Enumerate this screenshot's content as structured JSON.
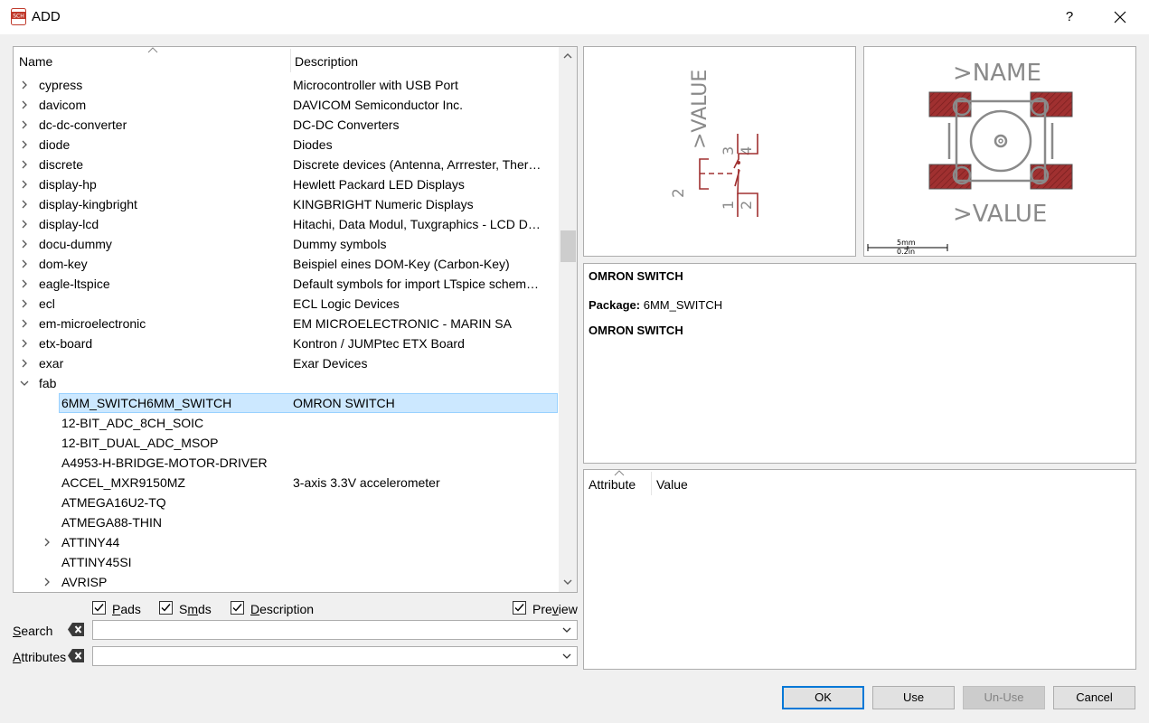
{
  "window": {
    "title": "ADD",
    "help_label": "?"
  },
  "tree": {
    "columns": {
      "name": "Name",
      "description": "Description"
    },
    "rows": [
      {
        "name": "cypress",
        "description": "Microcontroller with USB Port",
        "level": 0,
        "expander": "collapsed"
      },
      {
        "name": "davicom",
        "description": "DAVICOM Semiconductor Inc.",
        "level": 0,
        "expander": "collapsed"
      },
      {
        "name": "dc-dc-converter",
        "description": "DC-DC Converters",
        "level": 0,
        "expander": "collapsed"
      },
      {
        "name": "diode",
        "description": "Diodes",
        "level": 0,
        "expander": "collapsed"
      },
      {
        "name": "discrete",
        "description": "Discrete devices (Antenna, Arrrester, Ther…",
        "level": 0,
        "expander": "collapsed"
      },
      {
        "name": "display-hp",
        "description": "Hewlett Packard LED Displays",
        "level": 0,
        "expander": "collapsed"
      },
      {
        "name": "display-kingbright",
        "description": "KINGBRIGHT Numeric Displays",
        "level": 0,
        "expander": "collapsed"
      },
      {
        "name": "display-lcd",
        "description": "Hitachi, Data Modul, Tuxgraphics - LCD D…",
        "level": 0,
        "expander": "collapsed"
      },
      {
        "name": "docu-dummy",
        "description": "Dummy symbols",
        "level": 0,
        "expander": "collapsed"
      },
      {
        "name": "dom-key",
        "description": "Beispiel eines DOM-Key (Carbon-Key)",
        "level": 0,
        "expander": "collapsed"
      },
      {
        "name": "eagle-ltspice",
        "description": "Default symbols for import LTspice schem…",
        "level": 0,
        "expander": "collapsed"
      },
      {
        "name": "ecl",
        "description": "ECL Logic Devices",
        "level": 0,
        "expander": "collapsed"
      },
      {
        "name": "em-microelectronic",
        "description": "EM MICROELECTRONIC - MARIN SA",
        "level": 0,
        "expander": "collapsed"
      },
      {
        "name": "etx-board",
        "description": "Kontron / JUMPtec ETX Board",
        "level": 0,
        "expander": "collapsed"
      },
      {
        "name": "exar",
        "description": "Exar Devices",
        "level": 0,
        "expander": "collapsed"
      },
      {
        "name": "fab",
        "description": "",
        "level": 0,
        "expander": "expanded"
      },
      {
        "name": "6MM_SWITCH6MM_SWITCH",
        "description": "OMRON SWITCH",
        "level": 1,
        "expander": "none",
        "selected": true
      },
      {
        "name": "12-BIT_ADC_8CH_SOIC",
        "description": "",
        "level": 1,
        "expander": "none"
      },
      {
        "name": "12-BIT_DUAL_ADC_MSOP",
        "description": "",
        "level": 1,
        "expander": "none"
      },
      {
        "name": "A4953-H-BRIDGE-MOTOR-DRIVER",
        "description": "",
        "level": 1,
        "expander": "none"
      },
      {
        "name": "ACCEL_MXR9150MZ",
        "description": "3-axis 3.3V accelerometer",
        "level": 1,
        "expander": "none"
      },
      {
        "name": "ATMEGA16U2-TQ",
        "description": "",
        "level": 1,
        "expander": "none"
      },
      {
        "name": "ATMEGA88-THIN",
        "description": "",
        "level": 1,
        "expander": "none"
      },
      {
        "name": "ATTINY44",
        "description": "",
        "level": 1,
        "expander": "collapsed"
      },
      {
        "name": "ATTINY45SI",
        "description": "",
        "level": 1,
        "expander": "none"
      },
      {
        "name": "AVRISP",
        "description": "",
        "level": 1,
        "expander": "collapsed"
      }
    ]
  },
  "options": {
    "pads": {
      "label_u": "P",
      "label_rest": "ads",
      "checked": true
    },
    "smds": {
      "label_pre": "S",
      "label_u": "m",
      "label_rest": "ds",
      "checked": true
    },
    "description": {
      "label_u": "D",
      "label_rest": "escription",
      "checked": true
    },
    "preview": {
      "label_pre": "Pre",
      "label_u": "v",
      "label_rest": "iew",
      "checked": true
    }
  },
  "search": {
    "label_u": "S",
    "label_rest": "earch",
    "value": ""
  },
  "attributes": {
    "label_u": "A",
    "label_rest": "ttributes",
    "value": ""
  },
  "symbol_preview": {
    "value_label": ">VALUE",
    "part_number": "2",
    "pins": [
      "1",
      "2",
      "3",
      "4"
    ]
  },
  "package_preview": {
    "name_label": ">NAME",
    "value_label": ">VALUE",
    "scale_mm": "5mm",
    "scale_in": "0.2in"
  },
  "info": {
    "heading": "OMRON SWITCH",
    "package_label": "Package:",
    "package_value": "6MM_SWITCH",
    "description": "OMRON SWITCH"
  },
  "attr_table": {
    "columns": {
      "attribute": "Attribute",
      "value": "Value"
    }
  },
  "buttons": {
    "ok": "OK",
    "use": "Use",
    "unuse": "Un-Use",
    "cancel": "Cancel"
  },
  "colors": {
    "selection": "#cce8ff",
    "pad": "#a03030",
    "accent": "#0078d7"
  }
}
